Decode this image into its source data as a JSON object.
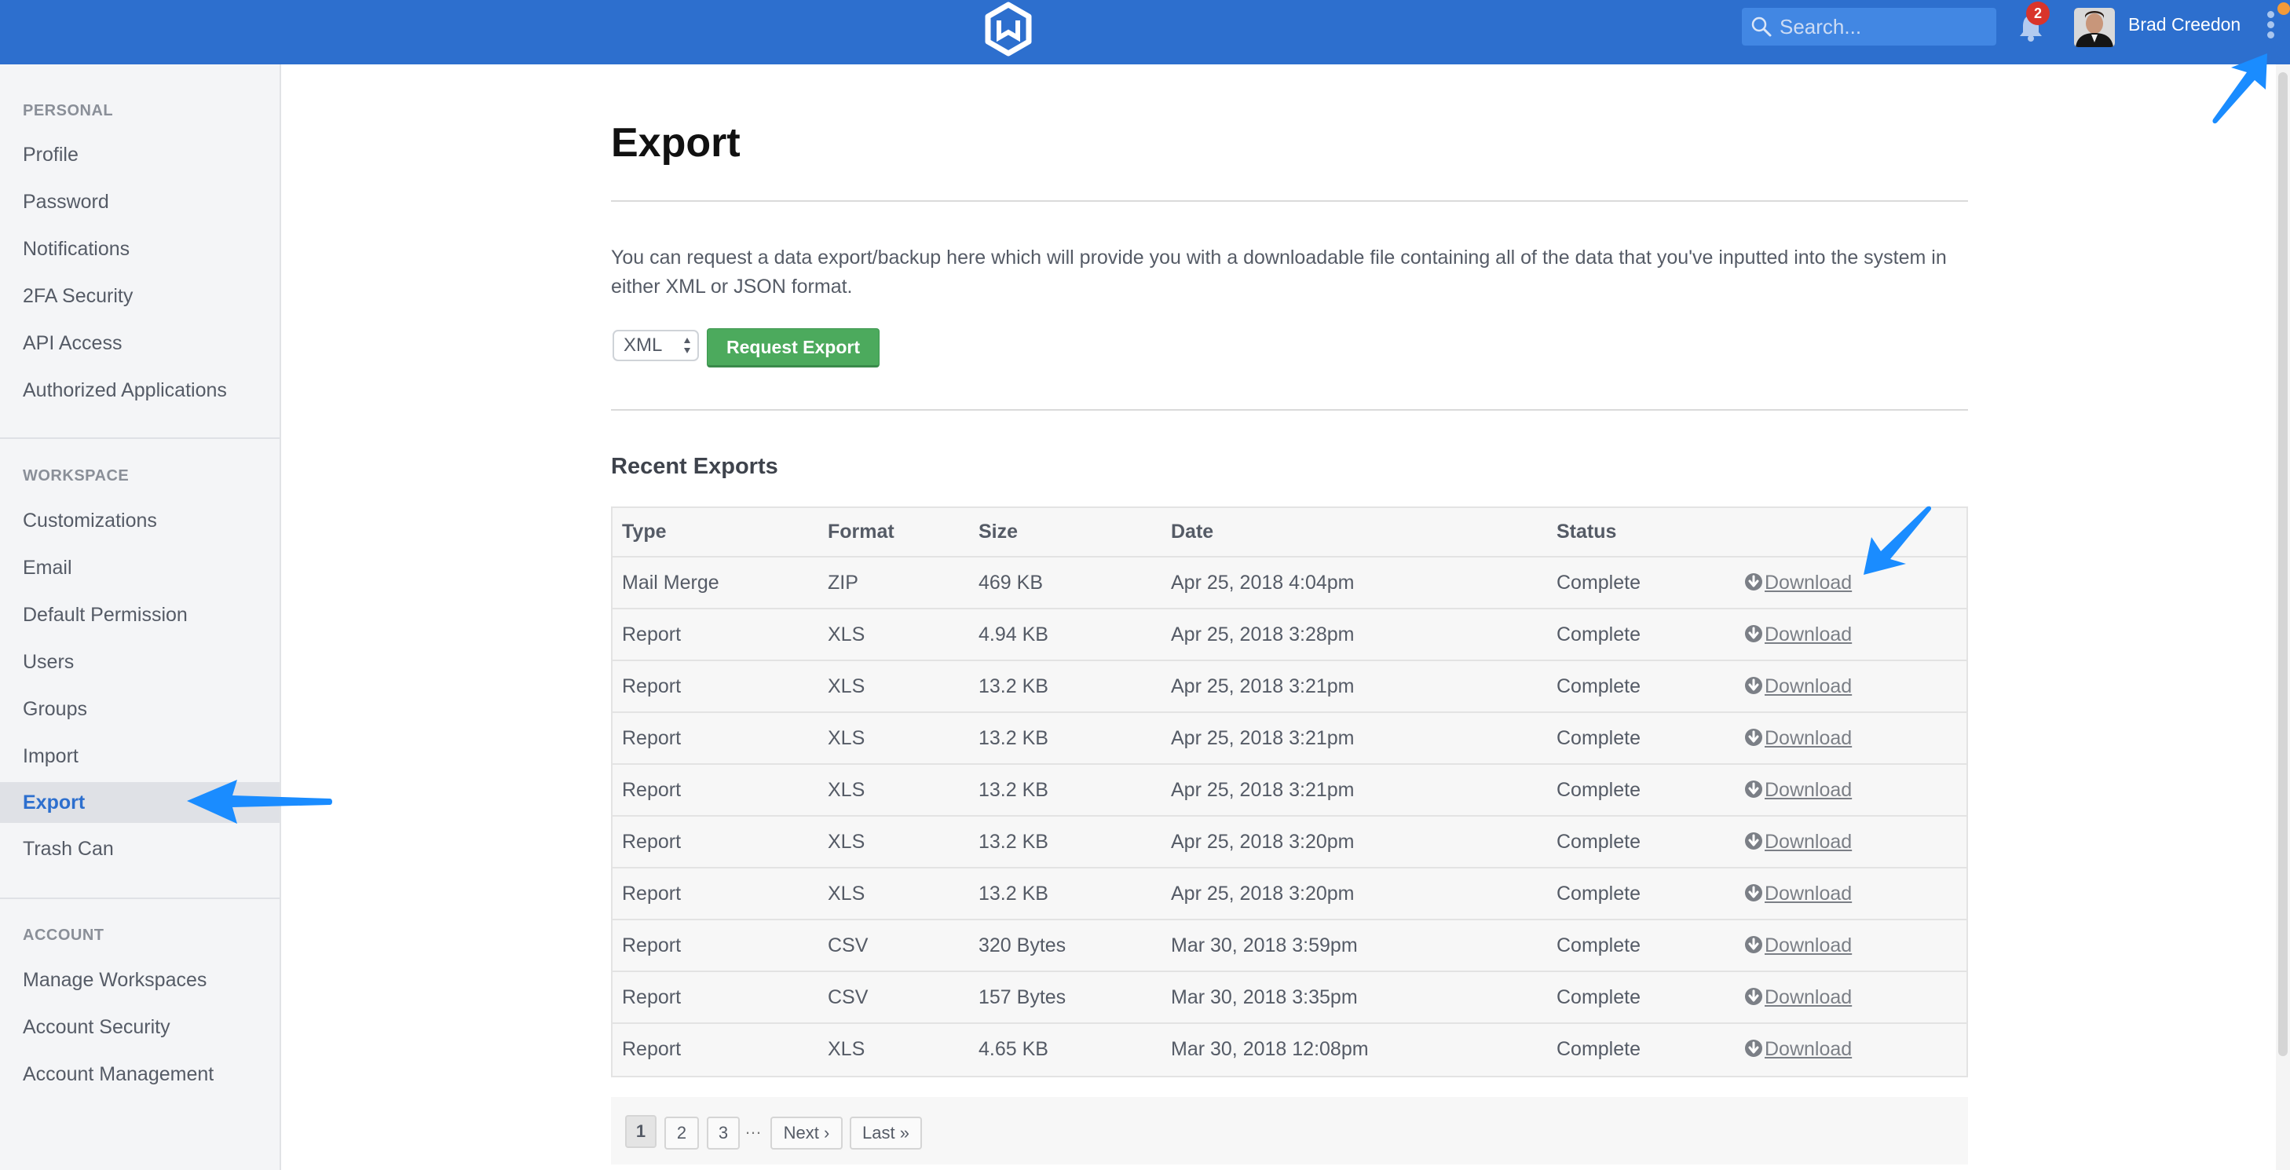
{
  "header": {
    "logo": "wrike-hexagon-logo",
    "search_placeholder": "Search...",
    "notification_count": "2",
    "user_name": "Brad Creedon"
  },
  "sidebar": {
    "sections": [
      {
        "heading": "PERSONAL",
        "items": [
          "Profile",
          "Password",
          "Notifications",
          "2FA Security",
          "API Access",
          "Authorized Applications"
        ]
      },
      {
        "heading": "WORKSPACE",
        "items": [
          "Customizations",
          "Email",
          "Default Permission",
          "Users",
          "Groups",
          "Import",
          "Export",
          "Trash Can"
        ]
      },
      {
        "heading": "ACCOUNT",
        "items": [
          "Manage Workspaces",
          "Account Security",
          "Account Management"
        ]
      }
    ],
    "active_item": "Export"
  },
  "main": {
    "title": "Export",
    "description": "You can request a data export/backup here which will provide you with a downloadable file containing all of the data that you've inputted into the system in either XML or JSON format.",
    "format_select": {
      "value": "XML"
    },
    "request_button": "Request Export",
    "recent_title": "Recent Exports",
    "table": {
      "columns": [
        "Type",
        "Format",
        "Size",
        "Date",
        "Status",
        ""
      ],
      "rows": [
        {
          "type": "Mail Merge",
          "format": "ZIP",
          "size": "469 KB",
          "date": "Apr 25, 2018 4:04pm",
          "status": "Complete",
          "action": "Download"
        },
        {
          "type": "Report",
          "format": "XLS",
          "size": "4.94 KB",
          "date": "Apr 25, 2018 3:28pm",
          "status": "Complete",
          "action": "Download"
        },
        {
          "type": "Report",
          "format": "XLS",
          "size": "13.2 KB",
          "date": "Apr 25, 2018 3:21pm",
          "status": "Complete",
          "action": "Download"
        },
        {
          "type": "Report",
          "format": "XLS",
          "size": "13.2 KB",
          "date": "Apr 25, 2018 3:21pm",
          "status": "Complete",
          "action": "Download"
        },
        {
          "type": "Report",
          "format": "XLS",
          "size": "13.2 KB",
          "date": "Apr 25, 2018 3:21pm",
          "status": "Complete",
          "action": "Download"
        },
        {
          "type": "Report",
          "format": "XLS",
          "size": "13.2 KB",
          "date": "Apr 25, 2018 3:20pm",
          "status": "Complete",
          "action": "Download"
        },
        {
          "type": "Report",
          "format": "XLS",
          "size": "13.2 KB",
          "date": "Apr 25, 2018 3:20pm",
          "status": "Complete",
          "action": "Download"
        },
        {
          "type": "Report",
          "format": "CSV",
          "size": "320 Bytes",
          "date": "Mar 30, 2018 3:59pm",
          "status": "Complete",
          "action": "Download"
        },
        {
          "type": "Report",
          "format": "CSV",
          "size": "157 Bytes",
          "date": "Mar 30, 2018 3:35pm",
          "status": "Complete",
          "action": "Download"
        },
        {
          "type": "Report",
          "format": "XLS",
          "size": "4.65 KB",
          "date": "Mar 30, 2018 12:08pm",
          "status": "Complete",
          "action": "Download"
        }
      ]
    },
    "pagination": {
      "pages": [
        "1",
        "2",
        "3"
      ],
      "current": "1",
      "ellipsis": "…",
      "next": "Next ›",
      "last": "Last »"
    }
  },
  "colors": {
    "header_bg": "#2d6fce",
    "accent": "#2d6fce",
    "button_green": "#4caa5d",
    "badge_red": "#d9342b",
    "annotation_arrow": "#1a8cff"
  }
}
